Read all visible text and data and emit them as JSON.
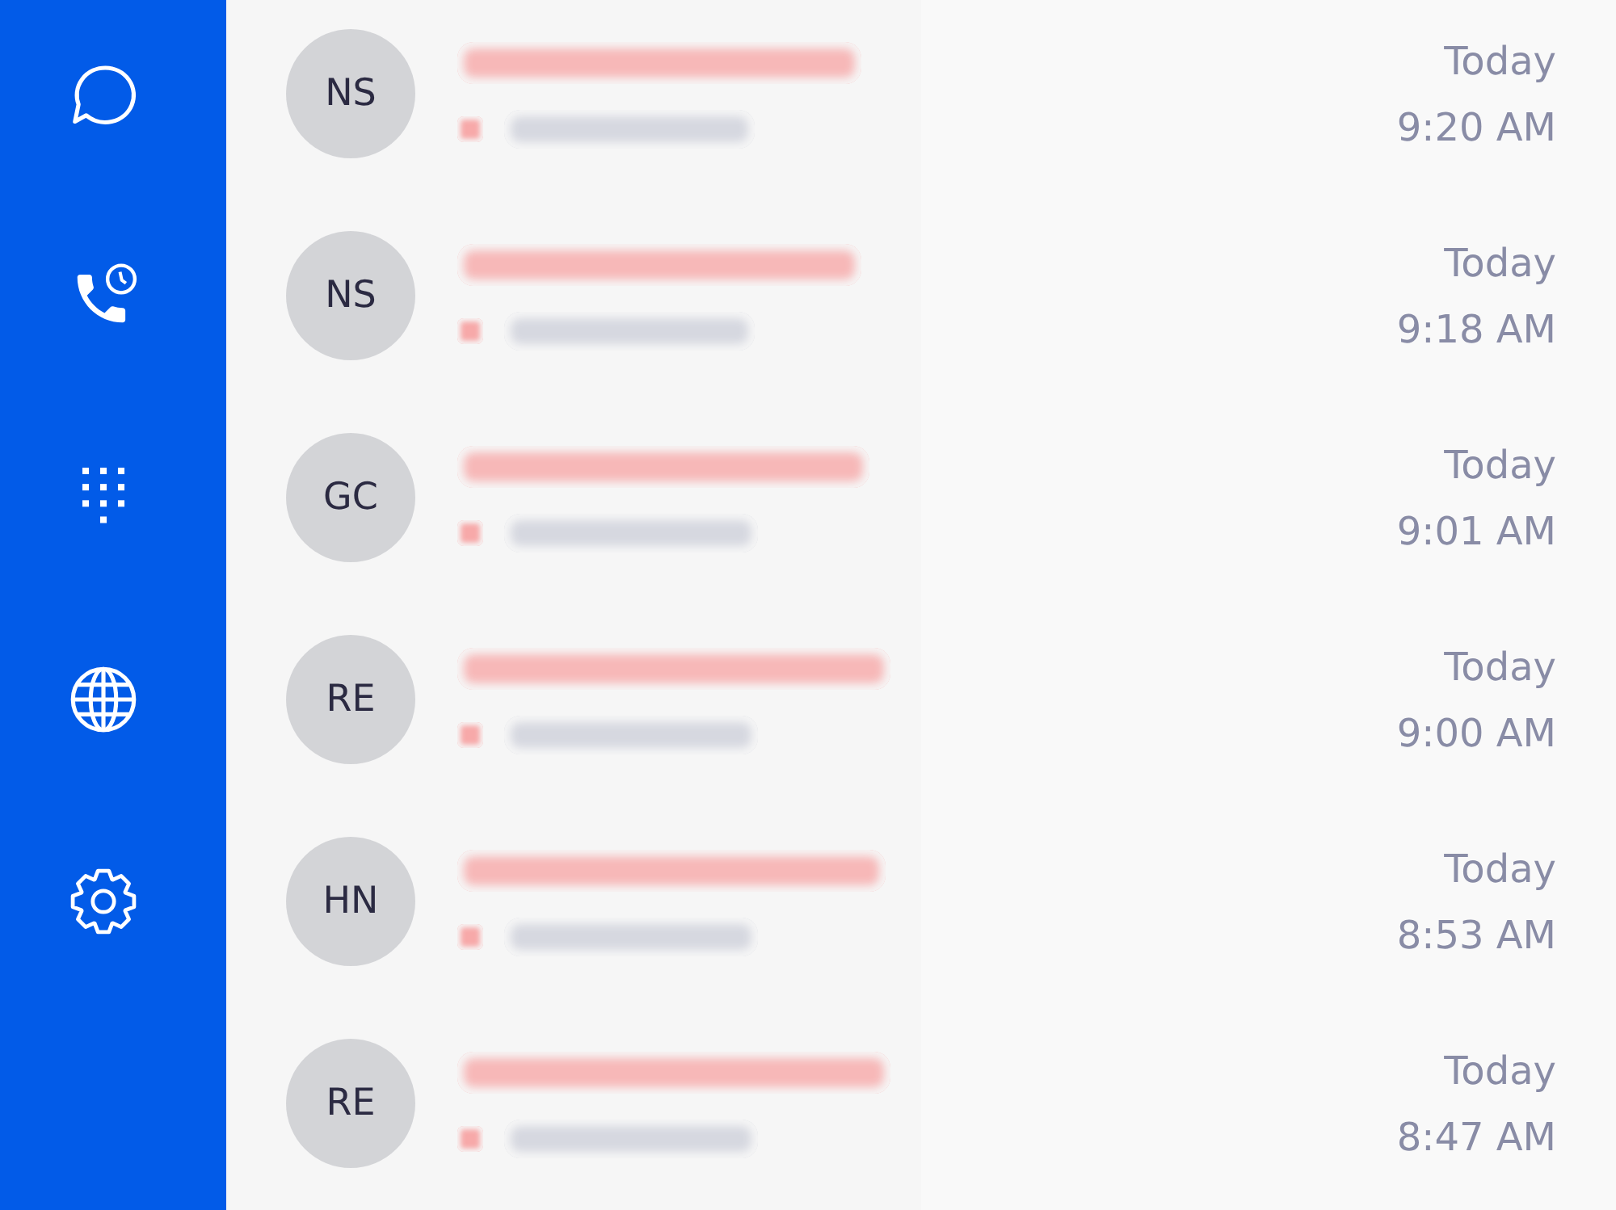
{
  "sidebar": {
    "items": [
      {
        "kind": "chat"
      },
      {
        "kind": "calls"
      },
      {
        "kind": "dialpad"
      },
      {
        "kind": "globe"
      },
      {
        "kind": "settings"
      }
    ]
  },
  "calls": [
    {
      "initials": "NS",
      "missed": true,
      "day": "Today",
      "time": "9:20 AM"
    },
    {
      "initials": "NS",
      "missed": true,
      "day": "Today",
      "time": "9:18 AM"
    },
    {
      "initials": "GC",
      "missed": true,
      "day": "Today",
      "time": "9:01 AM"
    },
    {
      "initials": "RE",
      "missed": true,
      "day": "Today",
      "time": "9:00 AM"
    },
    {
      "initials": "HN",
      "missed": true,
      "day": "Today",
      "time": "8:53 AM"
    },
    {
      "initials": "RE",
      "missed": true,
      "day": "Today",
      "time": "8:47 AM"
    }
  ]
}
